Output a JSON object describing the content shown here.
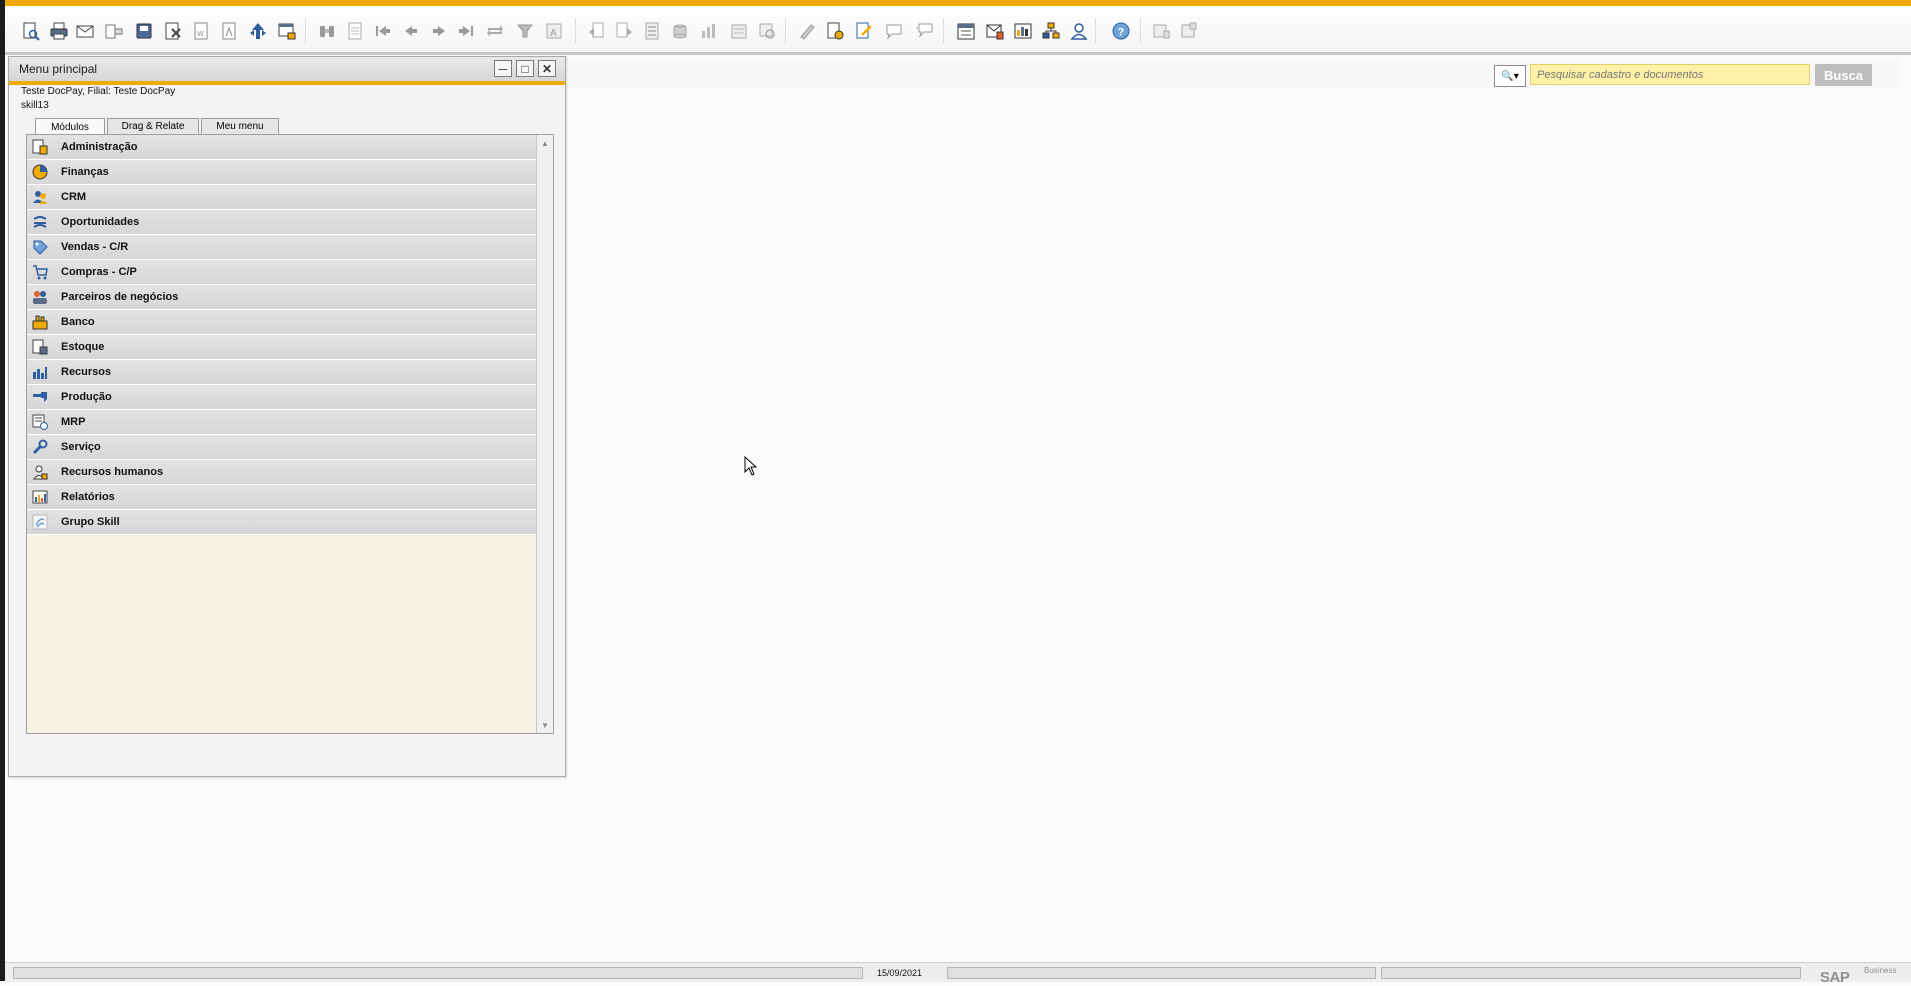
{
  "toolbar": {
    "buttons": [
      "print-preview-icon",
      "print-icon",
      "email-icon",
      "send-icon",
      "fax-icon",
      "export-excel-icon",
      "export-word-icon",
      "export-pdf-icon",
      "launch-app-icon",
      "lock-screen-icon",
      "find-icon",
      "add-icon",
      "first-record-icon",
      "previous-record-icon",
      "next-record-icon",
      "last-record-icon",
      "refresh-icon",
      "filter-icon",
      "sort-icon",
      "base-document-icon",
      "target-document-icon",
      "journal-icon",
      "payment-icon",
      "gross-profit-icon",
      "volume-weight-icon",
      "layout-designer-icon",
      "settings-icon",
      "document-settings-icon",
      "form-settings-icon",
      "message-icon",
      "messages-icon",
      "calendar-icon",
      "inbox-icon",
      "dashboard-icon",
      "org-chart-icon",
      "user-icon",
      "help-icon",
      "window-list-icon",
      "window-copy-icon"
    ]
  },
  "search": {
    "placeholder": "Pesquisar cadastro e documentos",
    "button_label": "Busca",
    "dropdown_icon": "search-icon"
  },
  "main_menu": {
    "title": "Menu principal",
    "company": "Teste DocPay, Filial: Teste DocPay",
    "user": "skill13",
    "tabs": [
      "Módulos",
      "Drag & Relate",
      "Meu menu"
    ],
    "active_tab": "Módulos",
    "modules": [
      {
        "label": "Administração",
        "icon": "administration-icon"
      },
      {
        "label": "Finanças",
        "icon": "finance-icon"
      },
      {
        "label": "CRM",
        "icon": "crm-icon"
      },
      {
        "label": "Oportunidades",
        "icon": "opportunities-icon"
      },
      {
        "label": "Vendas - C/R",
        "icon": "sales-icon"
      },
      {
        "label": "Compras - C/P",
        "icon": "purchasing-icon"
      },
      {
        "label": "Parceiros de negócios",
        "icon": "business-partners-icon"
      },
      {
        "label": "Banco",
        "icon": "banking-icon"
      },
      {
        "label": "Estoque",
        "icon": "inventory-icon"
      },
      {
        "label": "Recursos",
        "icon": "resources-icon"
      },
      {
        "label": "Produção",
        "icon": "production-icon"
      },
      {
        "label": "MRP",
        "icon": "mrp-icon"
      },
      {
        "label": "Serviço",
        "icon": "service-icon"
      },
      {
        "label": "Recursos humanos",
        "icon": "human-resources-icon"
      },
      {
        "label": "Relatórios",
        "icon": "reports-icon"
      },
      {
        "label": "Grupo Skill",
        "icon": "grupo-skill-icon"
      }
    ]
  },
  "status_bar": {
    "date": "15/09/2021",
    "logo_text": "SAP",
    "logo_subtext": "Business"
  },
  "colors": {
    "accent": "#f0ab00",
    "search_field": "#fff2a8",
    "search_button": "#bdbdbd",
    "module_row": "#dcdcdc",
    "panel_background": "#f5f1e3"
  }
}
